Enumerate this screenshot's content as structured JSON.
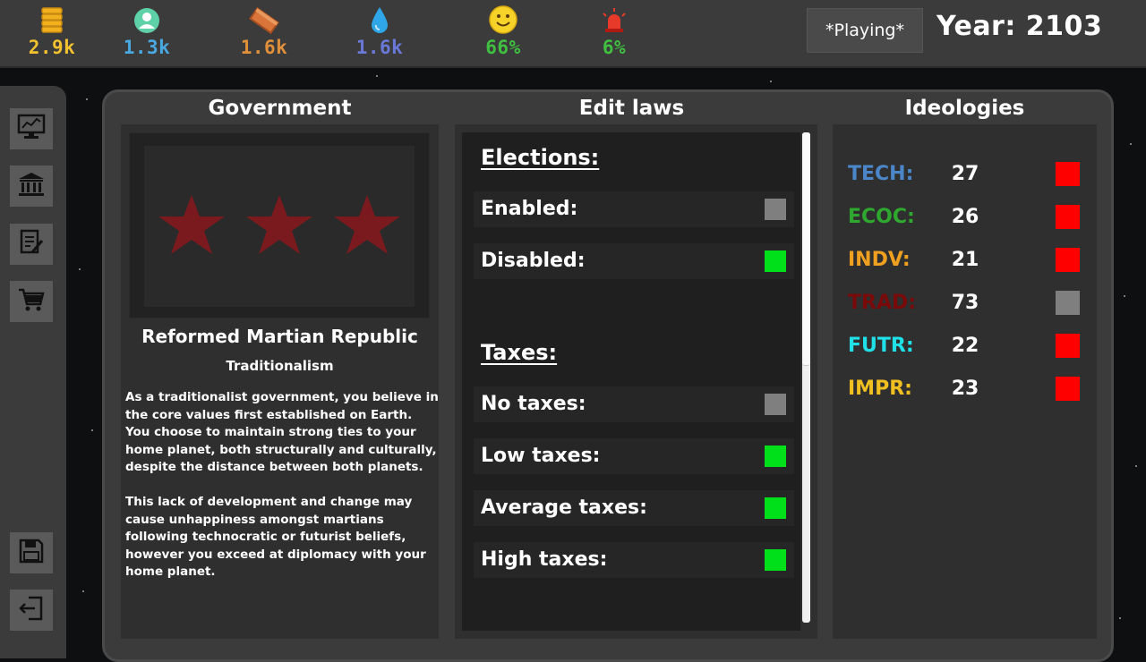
{
  "resources": [
    {
      "icon": "coins-icon",
      "value": "2.9k",
      "color": "#f2c230"
    },
    {
      "icon": "population-icon",
      "value": "1.3k",
      "color": "#4aa8e0"
    },
    {
      "icon": "brick-icon",
      "value": "1.6k",
      "color": "#e0903a"
    },
    {
      "icon": "water-drop-icon",
      "value": "1.6k",
      "color": "#6a78d8"
    },
    {
      "icon": "smiley-icon",
      "value": "66%",
      "color": "#40c040"
    },
    {
      "icon": "alarm-siren-icon",
      "value": "6%",
      "color": "#40c040"
    }
  ],
  "status": {
    "label": "*Playing*"
  },
  "year": {
    "label": "Year: 2103"
  },
  "sidebar": [
    {
      "name": "stats-monitor",
      "icon": "monitor-chart-icon"
    },
    {
      "name": "government",
      "icon": "bank-building-icon"
    },
    {
      "name": "laws-document",
      "icon": "document-edit-icon"
    },
    {
      "name": "shop-cart",
      "icon": "shopping-cart-icon"
    },
    {
      "name": "save",
      "icon": "floppy-disk-icon"
    },
    {
      "name": "exit",
      "icon": "exit-door-icon"
    }
  ],
  "government": {
    "heading": "Government",
    "name": "Reformed Martian Republic",
    "ideology": "Traditionalism",
    "desc1": "As a traditionalist government, you believe in the core values first established on Earth. You choose to maintain strong ties to your home planet, both structurally and culturally, despite the distance between both planets.",
    "desc2": "This lack of development and change may cause unhappiness amongst martians following technocratic or futurist beliefs, however you exceed at diplomacy with your home planet."
  },
  "laws": {
    "heading": "Edit laws",
    "elections": {
      "title": "Elections:",
      "options": [
        {
          "label": "Enabled:",
          "color": "#7f7f7f"
        },
        {
          "label": "Disabled:",
          "color": "#00e01a"
        }
      ]
    },
    "taxes": {
      "title": "Taxes:",
      "options": [
        {
          "label": "No taxes:",
          "color": "#7f7f7f"
        },
        {
          "label": "Low taxes:",
          "color": "#00e01a"
        },
        {
          "label": "Average taxes:",
          "color": "#00e01a"
        },
        {
          "label": "High taxes:",
          "color": "#00e01a"
        }
      ]
    }
  },
  "ideologies": {
    "heading": "Ideologies",
    "items": [
      {
        "name": "TECH:",
        "value": "27",
        "name_color": "#4a86c8",
        "box_color": "#ff0000"
      },
      {
        "name": "ECOC:",
        "value": "26",
        "name_color": "#2ea82e",
        "box_color": "#ff0000"
      },
      {
        "name": "INDV:",
        "value": "21",
        "name_color": "#f0a020",
        "box_color": "#ff0000"
      },
      {
        "name": "TRAD:",
        "value": "73",
        "name_color": "#7a0a0a",
        "box_color": "#7f7f7f"
      },
      {
        "name": "FUTR:",
        "value": "22",
        "name_color": "#20e0e8",
        "box_color": "#ff0000"
      },
      {
        "name": "IMPR:",
        "value": "23",
        "name_color": "#f0c020",
        "box_color": "#ff0000"
      }
    ]
  }
}
